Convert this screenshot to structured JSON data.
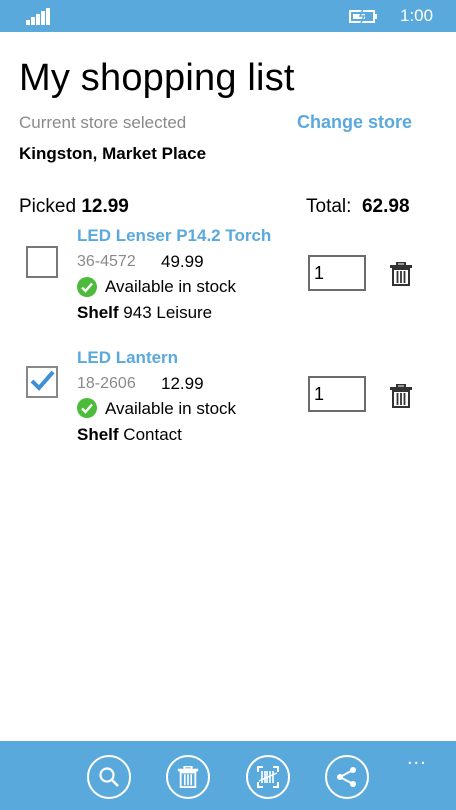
{
  "status_bar": {
    "time": "1:00"
  },
  "header": {
    "title": "My shopping list",
    "store_label": "Current store selected",
    "change_store": "Change store",
    "store_name": "Kingston, Market Place"
  },
  "summary": {
    "picked_label": "Picked",
    "picked_value": "12.99",
    "total_label": "Total:",
    "total_value": "62.98"
  },
  "items": [
    {
      "name": "LED Lenser P14.2 Torch",
      "code": "36-4572",
      "price": "49.99",
      "stock": "Available in stock",
      "shelf_label": "Shelf",
      "shelf_value": "943 Leisure",
      "quantity": "1",
      "checked": false
    },
    {
      "name": "LED Lantern",
      "code": "18-2606",
      "price": "12.99",
      "stock": "Available in stock",
      "shelf_label": "Shelf",
      "shelf_value": "Contact",
      "quantity": "1",
      "checked": true
    }
  ],
  "app_bar": {
    "buttons": [
      "search-icon",
      "delete-icon",
      "barcode-scan-icon",
      "share-icon"
    ],
    "more": "..."
  },
  "colors": {
    "accent": "#5aa9dc",
    "success": "#4cbb3a",
    "muted": "#8a8a8a"
  }
}
